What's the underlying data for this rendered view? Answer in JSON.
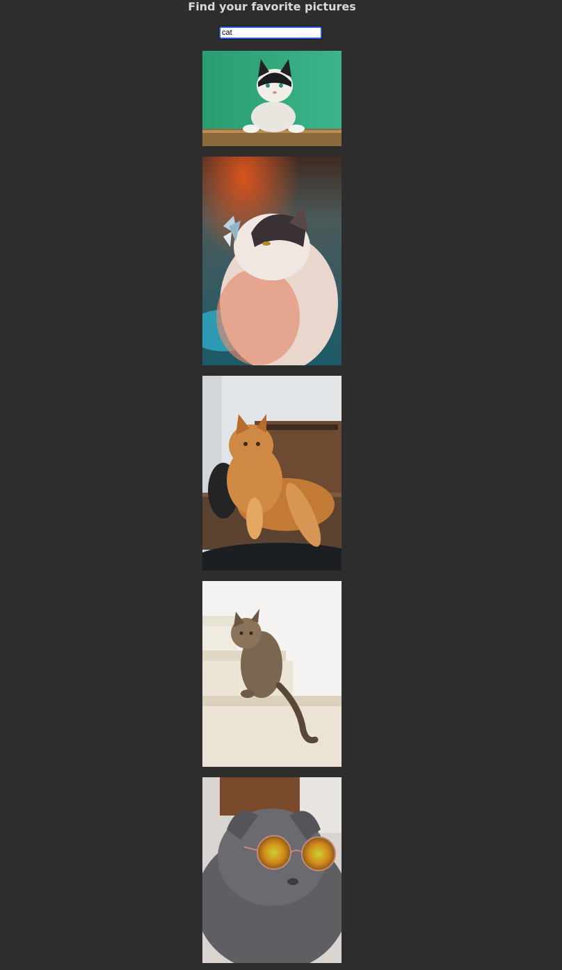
{
  "header": {
    "title": "Find your favorite pictures"
  },
  "search": {
    "value": "cat"
  },
  "gallery": {
    "images": [
      {
        "subject": "black-and-white cat on green background"
      },
      {
        "subject": "fluffy cat with butterfly on nose"
      },
      {
        "subject": "orange long-haired cat on wooden table"
      },
      {
        "subject": "tabby cat sitting on white stairs"
      },
      {
        "subject": "grey fold cat wearing round sunglasses"
      }
    ]
  }
}
